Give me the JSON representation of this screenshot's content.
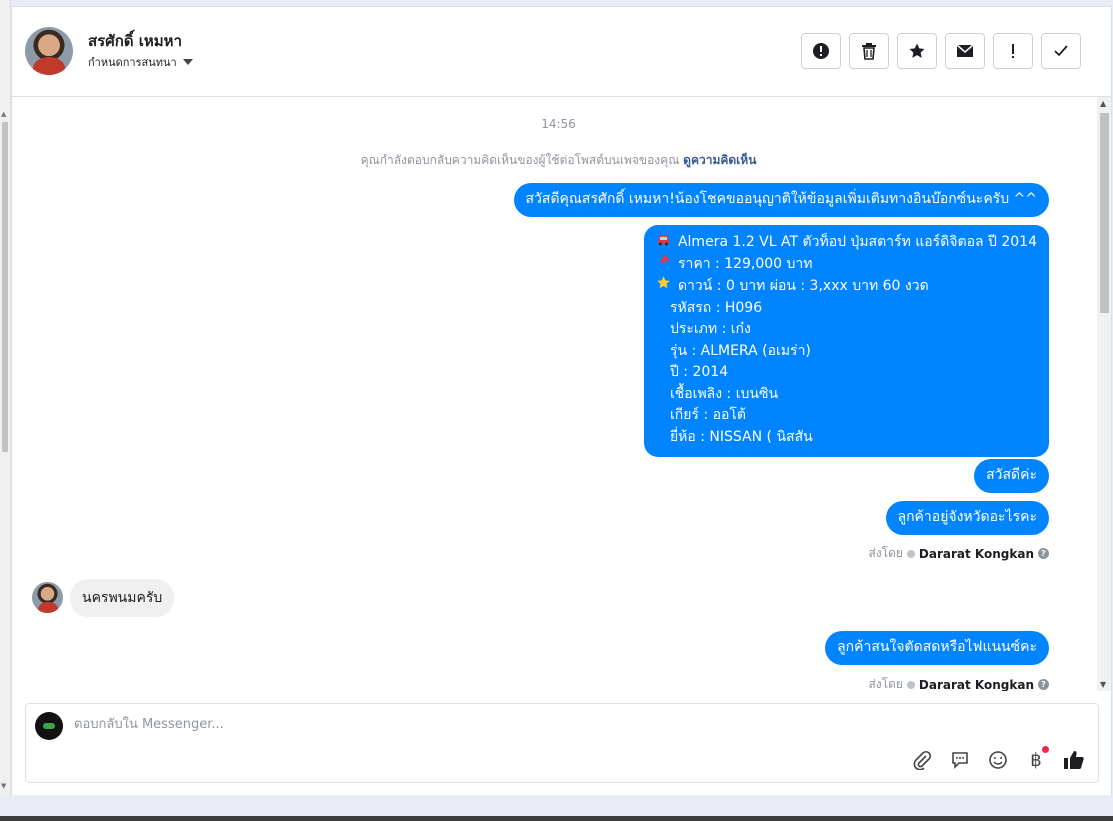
{
  "header": {
    "name": "สรศักดิ์ เหมหา",
    "subtitle": "กำหนดการสนทนา"
  },
  "toolbar": {
    "buttons": [
      "report-icon",
      "trash-icon",
      "star-icon",
      "mail-icon",
      "exclamation-icon",
      "check-icon"
    ]
  },
  "chat": {
    "timestamp": "14:56",
    "notice_text": "คุณกำลังตอบกลับความคิดเห็นของผู้ใช้ต่อโพสต์บนเพจของคุณ",
    "notice_link": "ดูความคิดเห็น",
    "messages": {
      "m1": "สวัสดีคุณสรศักดิ์ เหมหา!น้องโชคขออนุญาติให้ข้อมูลเพิ่มเติมทางอินบ๊อกซ์นะครับ ^^",
      "details": {
        "l1": "Almera 1.2 VL AT ตัวท็อป ปุ่มสตาร์ท แอร์ดิจิตอล ปี 2014",
        "l2": "ราคา : 129,000 บาท",
        "l3": "ดาวน์ : 0 บาท ผ่อน : 3,xxx บาท 60 งวด",
        "l4": "รหัสรถ : H096",
        "l5": "ประเภท : เก๋ง",
        "l6": "รุ่น : ALMERA (อเมร่า)",
        "l7": "ปี : 2014",
        "l8": "เชื้อเพลิง : เบนซิน",
        "l9": "เกียร์ : ออโต้",
        "l10": "ยี่ห้อ : NISSAN ( นิสสัน"
      },
      "m3": "สวัสดีค่ะ",
      "m4": "ลูกค้าอยู่จังหวัดอะไรคะ",
      "incoming1": "นครพนมครับ",
      "m5": "ลูกค้าสนใจตัดสดหรือไฟแนนซ์คะ"
    },
    "sent_by_label": "ส่งโดย",
    "sent_by_name": "Dararat Kongkan"
  },
  "composer": {
    "placeholder": "ตอบกลับใน Messenger...",
    "tools": [
      "paperclip-icon",
      "saved-reply-icon",
      "emoji-icon",
      "baht-icon",
      "thumbs-up-icon"
    ]
  },
  "colors": {
    "outgoing_bubble": "#0084ff",
    "incoming_bubble": "#f1f0f0",
    "link": "#385898"
  }
}
